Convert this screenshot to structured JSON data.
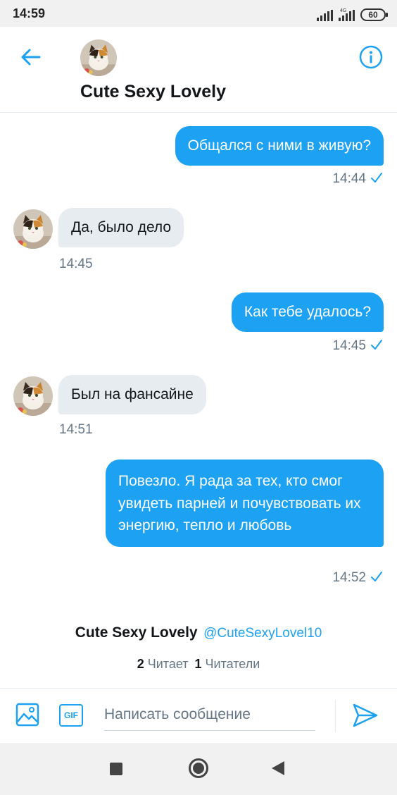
{
  "status_bar": {
    "time": "14:59",
    "network": "4G",
    "battery": "60"
  },
  "header": {
    "title": "Cute Sexy Lovely",
    "avatar": "calico-cat-avatar",
    "back_icon": "arrow-left-icon",
    "info_icon": "info-icon"
  },
  "messages": [
    {
      "direction": "out",
      "text": "Общался с ними в живую?",
      "time": "14:44",
      "read": true
    },
    {
      "direction": "in",
      "text": "Да, было дело",
      "time": "14:45"
    },
    {
      "direction": "out",
      "text": "Как тебе удалось?",
      "time": "14:45",
      "read": true
    },
    {
      "direction": "in",
      "text": "Был на фансайне",
      "time": "14:51"
    },
    {
      "direction": "out",
      "text": "Повезло. Я рада за тех, кто смог увидеть парней и почувствовать их энергию, тепло и любовь",
      "time": "14:52",
      "read": true
    }
  ],
  "profile": {
    "name": "Cute Sexy Lovely",
    "handle": "@CuteSexyLovel10",
    "following_count": "2",
    "following_label": "Читает",
    "followers_count": "1",
    "followers_label": "Читатели"
  },
  "composer": {
    "placeholder": "Написать сообщение",
    "gif_label": "GIF",
    "image_icon": "image-icon",
    "send_icon": "send-icon"
  },
  "colors": {
    "accent": "#1da1f2",
    "incoming_bubble": "#e6ecf0",
    "muted_text": "#657786"
  }
}
